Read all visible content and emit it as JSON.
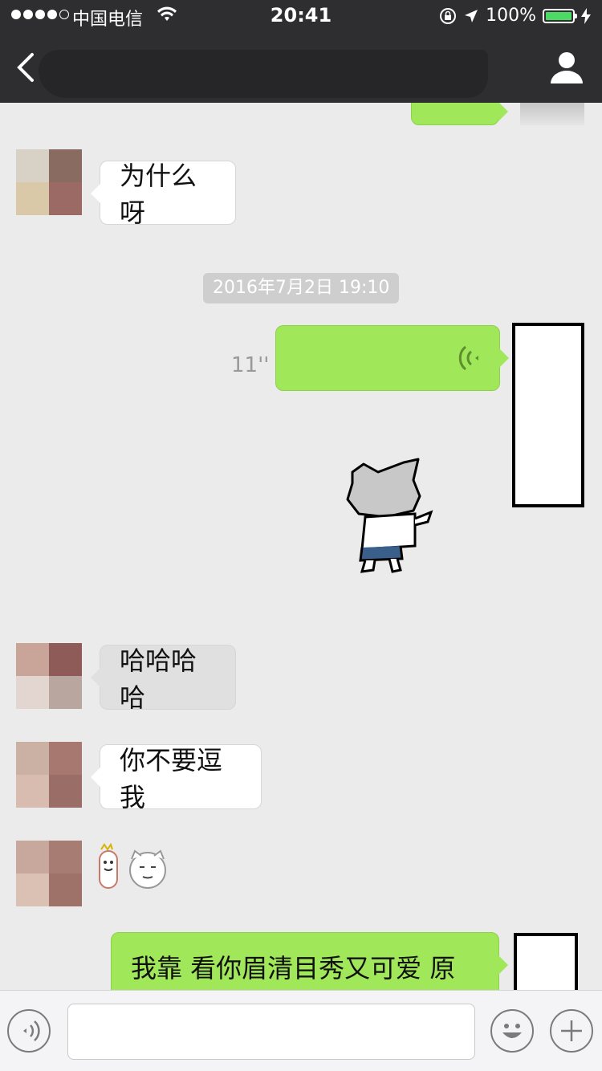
{
  "status_bar": {
    "carrier": "中国电信",
    "time": "20:41",
    "battery_percent": "100%",
    "battery_level": 1.0,
    "battery_color": "#4cd964"
  },
  "nav": {
    "back_icon": "chevron-left-icon",
    "profile_icon": "person-icon"
  },
  "messages": [
    {
      "id": "m1",
      "direction": "in",
      "text": "为什么呀"
    },
    {
      "id": "ts",
      "type": "timestamp",
      "text": "2016年7月2日 19:10"
    },
    {
      "id": "m2",
      "direction": "out",
      "type": "voice",
      "duration": "11''"
    },
    {
      "id": "m3",
      "direction": "out",
      "type": "sticker",
      "sticker": "cat-pointing-sticker"
    },
    {
      "id": "m4",
      "direction": "in",
      "text": "哈哈哈哈"
    },
    {
      "id": "m5",
      "direction": "in",
      "text": "你不要逗我"
    },
    {
      "id": "m6",
      "direction": "in",
      "type": "sticker",
      "sticker": "meme-faces-sticker"
    },
    {
      "id": "m7",
      "direction": "out",
      "text": "我靠 看你眉清目秀又可爱 原来"
    }
  ],
  "input_bar": {
    "voice_icon": "voice-mode-icon",
    "emoji_icon": "emoji-icon",
    "plus_icon": "plus-icon",
    "text_value": ""
  },
  "colors": {
    "nav_background": "#2e2e30",
    "chat_background": "#ebebeb",
    "outgoing_bubble": "#a0e759",
    "incoming_bubble": "#ffffff",
    "timestamp_background": "#cecece"
  }
}
